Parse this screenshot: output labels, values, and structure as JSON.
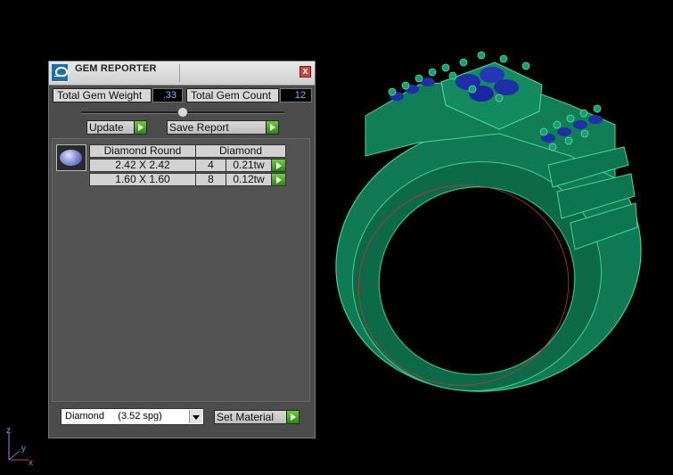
{
  "panel": {
    "title": "GEM REPORTER",
    "close_symbol": "x",
    "total_weight_label": "Total Gem Weight",
    "total_weight_value": ".33",
    "total_count_label": "Total Gem Count",
    "total_count_value": "12",
    "update_label": "Update",
    "save_report_label": "Save Report",
    "table": {
      "headers": [
        "Diamond Round",
        "Diamond"
      ],
      "rows": [
        {
          "size": "2.42 X 2.42",
          "count": "4",
          "weight": "0.21tw"
        },
        {
          "size": "1.60 X 1.60",
          "count": "8",
          "weight": "0.12tw"
        }
      ]
    },
    "material_select": "Diamond     (3.52 spg)",
    "set_material_label": "Set Material"
  },
  "axes": {
    "z": "z",
    "y": "y",
    "x": "x"
  },
  "colors": {
    "ring_green": "#0f7a55",
    "gem_blue": "#1f2fa8",
    "value_text": "#7fb4ff",
    "play_green": "#3aa81a"
  },
  "icons": [
    "gem-reporter-app-icon",
    "close-icon",
    "play-arrow-icon",
    "gem-thumbnail-icon",
    "dropdown-arrow-icon",
    "axis-gizmo-icon"
  ]
}
